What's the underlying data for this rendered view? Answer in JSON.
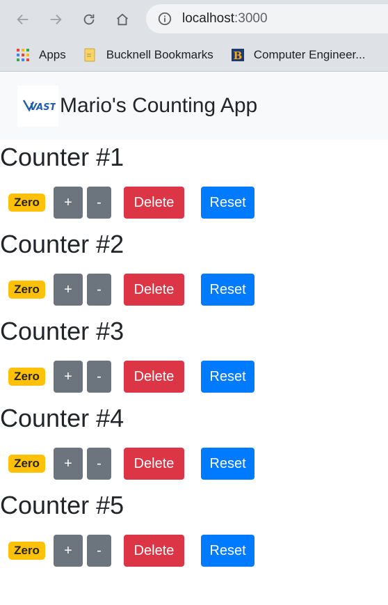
{
  "browser": {
    "url_host": "localhost",
    "url_port": ":3000",
    "bookmarks": [
      {
        "label": "Apps",
        "icon": "apps-grid-icon"
      },
      {
        "label": "Bucknell Bookmarks",
        "icon": "folder-icon"
      },
      {
        "label": "Computer Engineer...",
        "icon": "bucknell-b-icon"
      }
    ]
  },
  "navbar": {
    "brand": "Mario's Counting App",
    "logo_text": "VAST"
  },
  "counters": [
    {
      "title": "Counter #1",
      "badge": "Zero",
      "inc": "+",
      "dec": "-",
      "delete": "Delete",
      "reset": "Reset"
    },
    {
      "title": "Counter #2",
      "badge": "Zero",
      "inc": "+",
      "dec": "-",
      "delete": "Delete",
      "reset": "Reset"
    },
    {
      "title": "Counter #3",
      "badge": "Zero",
      "inc": "+",
      "dec": "-",
      "delete": "Delete",
      "reset": "Reset"
    },
    {
      "title": "Counter #4",
      "badge": "Zero",
      "inc": "+",
      "dec": "-",
      "delete": "Delete",
      "reset": "Reset"
    },
    {
      "title": "Counter #5",
      "badge": "Zero",
      "inc": "+",
      "dec": "-",
      "delete": "Delete",
      "reset": "Reset"
    }
  ],
  "colors": {
    "badge_warning": "#ffc107",
    "btn_secondary": "#6c757d",
    "btn_danger": "#dc3545",
    "btn_primary": "#007bff",
    "navbar_bg": "#f8f9fa"
  }
}
